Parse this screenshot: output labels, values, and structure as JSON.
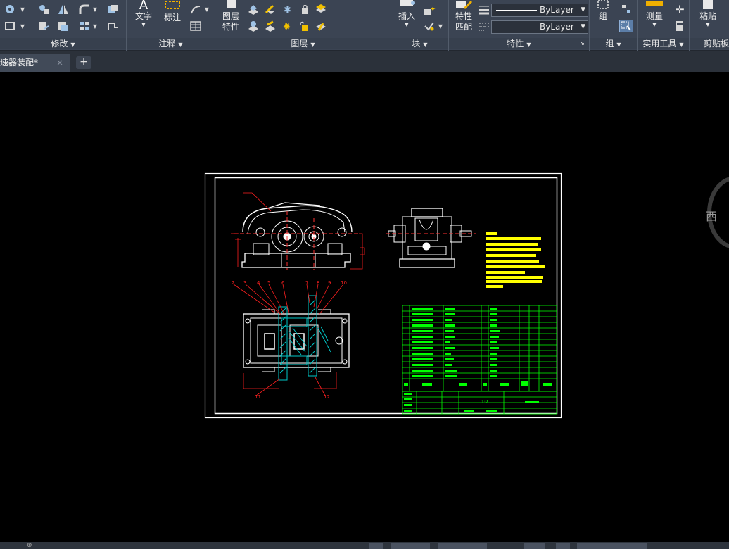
{
  "ribbon": {
    "modify": {
      "title": "修改"
    },
    "annotate": {
      "title": "注释",
      "text_label": "文字",
      "dim_label": "标注"
    },
    "layers": {
      "title": "图层",
      "layer_props_label": "图层\n特性",
      "layer_props_l1": "图层",
      "layer_props_l2": "特性"
    },
    "block": {
      "title": "块",
      "insert_label": "插入"
    },
    "properties": {
      "title": "特性",
      "match_l1": "特性",
      "match_l2": "匹配",
      "linetype_value": "ByLayer",
      "lineweight_value": "ByLayer"
    },
    "groups": {
      "title": "组",
      "group_label": "组"
    },
    "utilities": {
      "title": "实用工具",
      "measure_label": "测量"
    },
    "clipboard": {
      "title": "剪贴板",
      "paste_label": "粘贴"
    }
  },
  "tab": {
    "label": "速器装配*",
    "close": "×",
    "add": "+"
  },
  "viewcube": {
    "compass_label": "西"
  },
  "drawing": {
    "balloons_top": [
      "1"
    ],
    "balloons_plan": [
      "2",
      "3",
      "4",
      "5",
      "6",
      "7",
      "8",
      "9",
      "10"
    ],
    "balloons_bottom": [
      "11",
      "12"
    ],
    "title_block": {
      "scale": "1:2"
    }
  },
  "colors": {
    "ribbon_bg": "#3b4453",
    "canvas_bg": "#000000",
    "outline": "#ffffff",
    "leader": "#ff2020",
    "hatch": "#00c8c8",
    "table": "#00ff00",
    "notes": "#ffff00"
  }
}
